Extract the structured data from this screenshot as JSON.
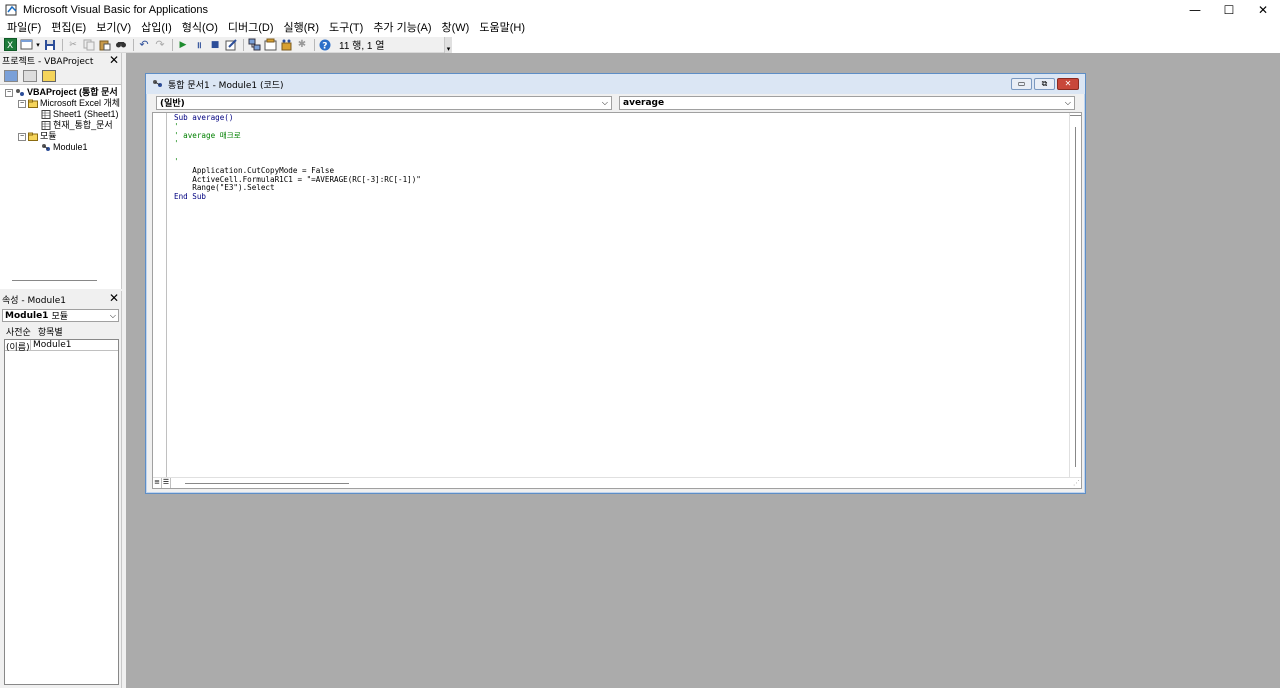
{
  "window": {
    "title": "Microsoft Visual Basic for Applications",
    "controls": {
      "minimize": "—",
      "maximize": "☐",
      "close": "✕"
    }
  },
  "menu": [
    "파일(F)",
    "편집(E)",
    "보기(V)",
    "삽입(I)",
    "형식(O)",
    "디버그(D)",
    "실행(R)",
    "도구(T)",
    "추가 기능(A)",
    "창(W)",
    "도움말(H)"
  ],
  "toolbar": {
    "position": "11 행, 1 열",
    "icons": [
      "excel-icon",
      "insert-icon",
      "save-icon",
      "cut-icon",
      "copy-icon",
      "paste-icon",
      "find-icon",
      "undo-icon",
      "redo-icon",
      "run-icon",
      "pause-icon",
      "stop-icon",
      "design-mode-icon",
      "project-explorer-icon",
      "properties-icon",
      "object-browser-icon",
      "toolbox-icon",
      "help-icon"
    ]
  },
  "project_pane": {
    "title": "프로젝트 - VBAProject",
    "close": "✕",
    "tree": [
      {
        "label": "VBAProject (통합 문서",
        "level": 0,
        "bold": true,
        "expander": "−"
      },
      {
        "label": "Microsoft Excel 개체",
        "level": 1,
        "bold": false,
        "expander": "−"
      },
      {
        "label": "Sheet1 (Sheet1)",
        "level": 2,
        "bold": false,
        "expander": ""
      },
      {
        "label": "현재_통합_문서",
        "level": 2,
        "bold": false,
        "expander": ""
      },
      {
        "label": "모듈",
        "level": 1,
        "bold": false,
        "expander": "−"
      },
      {
        "label": "Module1",
        "level": 2,
        "bold": false,
        "expander": ""
      }
    ]
  },
  "props_pane": {
    "title": "속성 - Module1",
    "close": "✕",
    "object_name": "Module1",
    "object_type": "모듈",
    "tabs": [
      "사전순",
      "항목별"
    ],
    "rows": [
      {
        "key": "(이름)",
        "value": "Module1"
      }
    ]
  },
  "code_window": {
    "title": "통합 문서1 - Module1 (코드)",
    "object_combo": "(일반)",
    "proc_combo": "average",
    "lines": [
      [
        {
          "t": "Sub average()",
          "c": "kw"
        }
      ],
      [
        {
          "t": "'",
          "c": "cm"
        }
      ],
      [
        {
          "t": "' average 매크로",
          "c": "cm"
        }
      ],
      [
        {
          "t": "'",
          "c": "cm"
        }
      ],
      [
        {
          "t": "",
          "c": "tx"
        }
      ],
      [
        {
          "t": "'",
          "c": "cm"
        }
      ],
      [
        {
          "t": "    Application.CutCopyMode = False",
          "c": "tx"
        }
      ],
      [
        {
          "t": "    ActiveCell.FormulaR1C1 = \"=AVERAGE(RC[-3]:RC[-1])\"",
          "c": "tx"
        }
      ],
      [
        {
          "t": "    Range(\"E3\").Select",
          "c": "tx"
        }
      ],
      [
        {
          "t": "End Sub",
          "c": "kw"
        }
      ]
    ]
  }
}
